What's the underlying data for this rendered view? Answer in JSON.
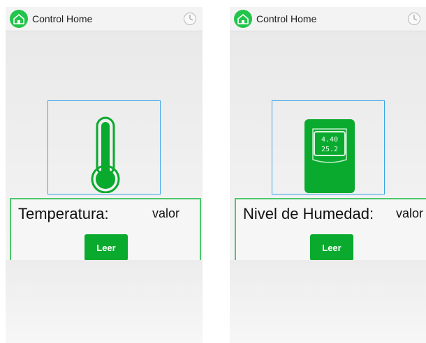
{
  "screens": [
    {
      "app_title": "Control Home",
      "sensor_icon": "thermometer-icon",
      "label": "Temperatura:",
      "value": "valor",
      "button": "Leer"
    },
    {
      "app_title": "Control Home",
      "sensor_icon": "humidity-meter-icon",
      "label": "Nivel de Humedad:",
      "value": "valor",
      "button": "Leer",
      "display_line1": "4.40",
      "display_line2": "25.2"
    }
  ],
  "colors": {
    "accent_green": "#0aaa2e",
    "frame_blue": "#3aa6e8",
    "panel_border_green": "#4cc76d"
  }
}
